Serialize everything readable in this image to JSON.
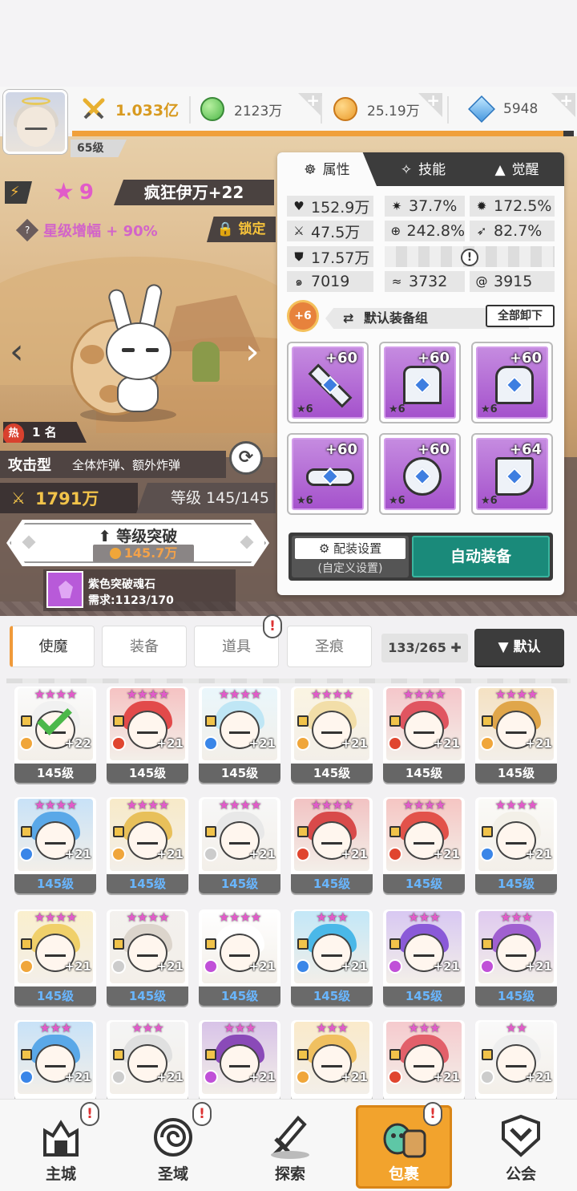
{
  "player": {
    "level": "65级"
  },
  "currencies": [
    {
      "name": "combat-power",
      "value": "1.033亿",
      "color": "#e8b030"
    },
    {
      "name": "green-gem",
      "value": "2123万",
      "color": "#6fcf5a"
    },
    {
      "name": "gold-coin",
      "value": "25.19万",
      "color": "#f0a63a"
    },
    {
      "name": "blue-crystal",
      "value": "5948",
      "color": "#5fa8e8"
    }
  ],
  "exp_progress": 0.98,
  "hero": {
    "star": "9",
    "name": "疯狂伊万+22",
    "boost": "星级增幅 + 90%",
    "lock_label": "锁定",
    "hot_rank": "1 名",
    "hot_label": "热",
    "type": "攻击型",
    "skill_desc": "全体炸弹、额外炸弹",
    "power": "1791万",
    "level": "等级 145/145",
    "breakthrough_title": "等级突破",
    "breakthrough_cost": "145.7万",
    "soulstone_name": "紫色突破魂石",
    "soulstone_req": "需求:1123/170"
  },
  "panel": {
    "tabs": [
      {
        "label": "属性",
        "icon": "attribute-icon"
      },
      {
        "label": "技能",
        "icon": "skill-icon"
      },
      {
        "label": "觉醒",
        "icon": "awaken-icon"
      }
    ],
    "stats": {
      "hp": "152.9万",
      "crit": "37.7%",
      "crit_dmg": "172.5%",
      "atk": "47.5万",
      "accuracy": "242.8%",
      "speed": "82.7%",
      "def": "17.57万",
      "s1": "7019",
      "s2": "3732",
      "s3": "3915"
    },
    "equip_level_badge": "+6",
    "equip_set": "默认装备组",
    "unequip_all": "全部卸下",
    "equipment": [
      {
        "name": "sword",
        "level": "+60",
        "stars": "★6"
      },
      {
        "name": "crown",
        "level": "+60",
        "stars": "★6"
      },
      {
        "name": "armor",
        "level": "+60",
        "stars": "★6"
      },
      {
        "name": "belt",
        "level": "+60",
        "stars": "★6"
      },
      {
        "name": "necklace",
        "level": "+60",
        "stars": "★6"
      },
      {
        "name": "boots",
        "level": "+64",
        "stars": "★6"
      }
    ],
    "config_label": "配装设置",
    "config_sub": "(自定义设置)",
    "auto_equip": "自动装备"
  },
  "inventory": {
    "tabs": [
      "使魔",
      "装备",
      "道具",
      "圣痕"
    ],
    "count": "133/265 ✚",
    "sort": "▼ 默认",
    "cards": [
      {
        "stars": "★★★★",
        "plus": "+22",
        "level": "145级",
        "hair": "#f1f1f1",
        "elem": "#f0a63a",
        "check": true
      },
      {
        "stars": "★★★★",
        "plus": "+21",
        "level": "145级",
        "hair": "#e24a4a",
        "elem": "#e0452f"
      },
      {
        "stars": "★★★★",
        "plus": "+21",
        "level": "145级",
        "hair": "#bfe6f5",
        "elem": "#3a86e8"
      },
      {
        "stars": "★★★★",
        "plus": "+21",
        "level": "145级",
        "hair": "#f2dea8",
        "elem": "#f0a63a"
      },
      {
        "stars": "★★★★",
        "plus": "+21",
        "level": "145级",
        "hair": "#e05560",
        "elem": "#e0452f"
      },
      {
        "stars": "★★★★",
        "plus": "+21",
        "level": "145级",
        "hair": "#e0a64a",
        "elem": "#f0a63a"
      },
      {
        "stars": "★★★★",
        "plus": "+21",
        "level": "145级",
        "hair": "#5aa8e8",
        "elem": "#3a86e8",
        "blue": true
      },
      {
        "stars": "★★★★",
        "plus": "+21",
        "level": "145级",
        "hair": "#e8c05a",
        "elem": "#f0a63a",
        "blue": true
      },
      {
        "stars": "★★★★",
        "plus": "+21",
        "level": "145级",
        "hair": "#e8e8e8",
        "elem": "#cccccc",
        "blue": true
      },
      {
        "stars": "★★★★",
        "plus": "+21",
        "level": "145级",
        "hair": "#d84a4a",
        "elem": "#e0452f",
        "blue": true
      },
      {
        "stars": "★★★★",
        "plus": "+21",
        "level": "145级",
        "hair": "#e2524a",
        "elem": "#e0452f",
        "blue": true
      },
      {
        "stars": "★★★★",
        "plus": "+21",
        "level": "145级",
        "hair": "#f3f0e8",
        "elem": "#3a86e8",
        "blue": true
      },
      {
        "stars": "★★★★",
        "plus": "+21",
        "level": "145级",
        "hair": "#f0d06a",
        "elem": "#f0a63a",
        "blue": true
      },
      {
        "stars": "★★★★",
        "plus": "+21",
        "level": "145级",
        "hair": "#dcd5cc",
        "elem": "#cccccc",
        "blue": true
      },
      {
        "stars": "★★★★",
        "plus": "+21",
        "level": "145级",
        "hair": "#ffffff",
        "elem": "#c050d8",
        "blue": true
      },
      {
        "stars": "★★★",
        "plus": "+21",
        "level": "145级",
        "hair": "#4ab8e8",
        "elem": "#3a86e8",
        "blue": true
      },
      {
        "stars": "★★★",
        "plus": "+21",
        "level": "145级",
        "hair": "#8a5ad8",
        "elem": "#c050d8",
        "blue": true
      },
      {
        "stars": "★★★",
        "plus": "+21",
        "level": "145级",
        "hair": "#a060d0",
        "elem": "#c050d8",
        "blue": true
      },
      {
        "stars": "★★★",
        "plus": "+21",
        "level": "",
        "hair": "#5aa8e8",
        "elem": "#3a86e8"
      },
      {
        "stars": "★★★",
        "plus": "+21",
        "level": "",
        "hair": "#e0e0e0",
        "elem": "#cccccc"
      },
      {
        "stars": "★★★",
        "plus": "+21",
        "level": "",
        "hair": "#8a4ab8",
        "elem": "#c050d8"
      },
      {
        "stars": "★★★",
        "plus": "+21",
        "level": "",
        "hair": "#f0c060",
        "elem": "#f0a63a"
      },
      {
        "stars": "★★★",
        "plus": "+21",
        "level": "",
        "hair": "#e2606a",
        "elem": "#e0452f"
      },
      {
        "stars": "★★",
        "plus": "+21",
        "level": "",
        "hair": "#eeeeee",
        "elem": "#cccccc"
      }
    ]
  },
  "nav": [
    {
      "label": "主城",
      "icon": "castle-icon",
      "notice": "!"
    },
    {
      "label": "圣域",
      "icon": "vortex-icon",
      "notice": "!"
    },
    {
      "label": "探索",
      "icon": "sword-icon"
    },
    {
      "label": "包裹",
      "icon": "bag-icon",
      "notice": "!",
      "active": true
    },
    {
      "label": "公会",
      "icon": "guild-icon"
    }
  ]
}
